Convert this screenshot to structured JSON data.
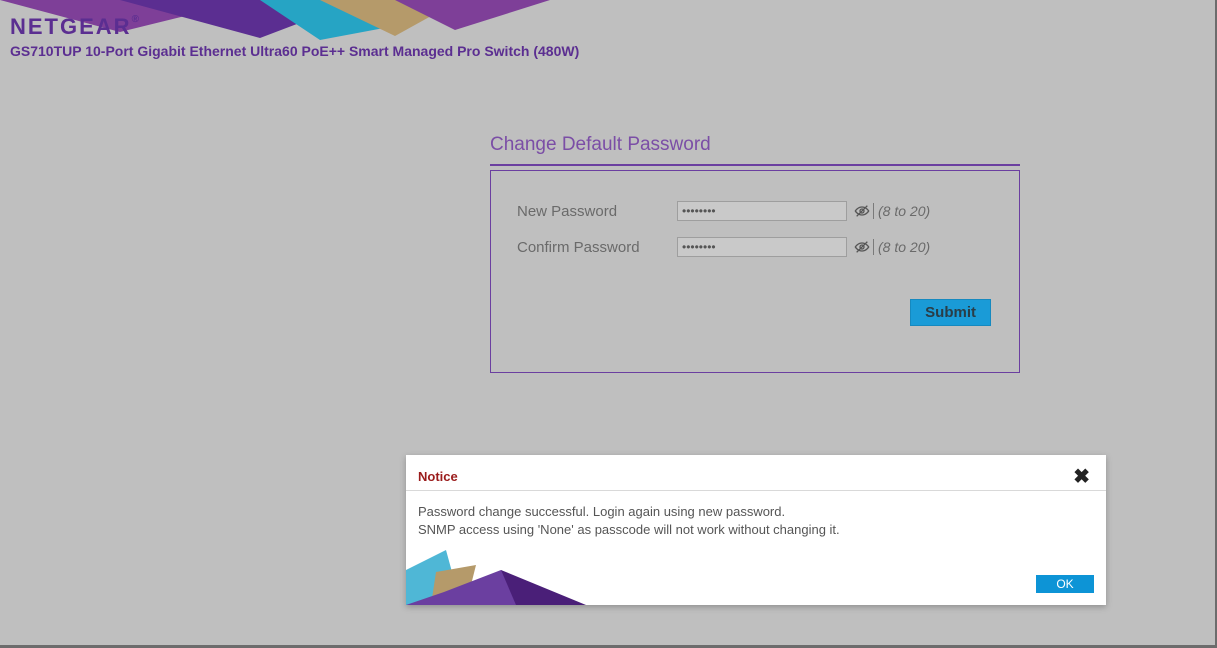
{
  "brand": {
    "name": "NETGEAR",
    "registered": "®",
    "subtitle": "GS710TUP 10-Port Gigabit Ethernet Ultra60 PoE++ Smart Managed Pro Switch (480W)"
  },
  "card": {
    "title": "Change Default Password",
    "fields": {
      "new_password_label": "New Password",
      "confirm_password_label": "Confirm Password",
      "hint": "(8 to 20)",
      "new_password_value": "••••••••",
      "confirm_password_value": "••••••••"
    },
    "submit_label": "Submit"
  },
  "modal": {
    "title": "Notice",
    "line1": "Password change successful. Login again using new password.",
    "line2": "SNMP access using 'None' as passcode will not work without changing it.",
    "ok_label": "OK"
  },
  "colors": {
    "brand_purple": "#5b2e91",
    "accent_cyan": "#1a9bd7",
    "notice_red": "#9b1c1c"
  }
}
